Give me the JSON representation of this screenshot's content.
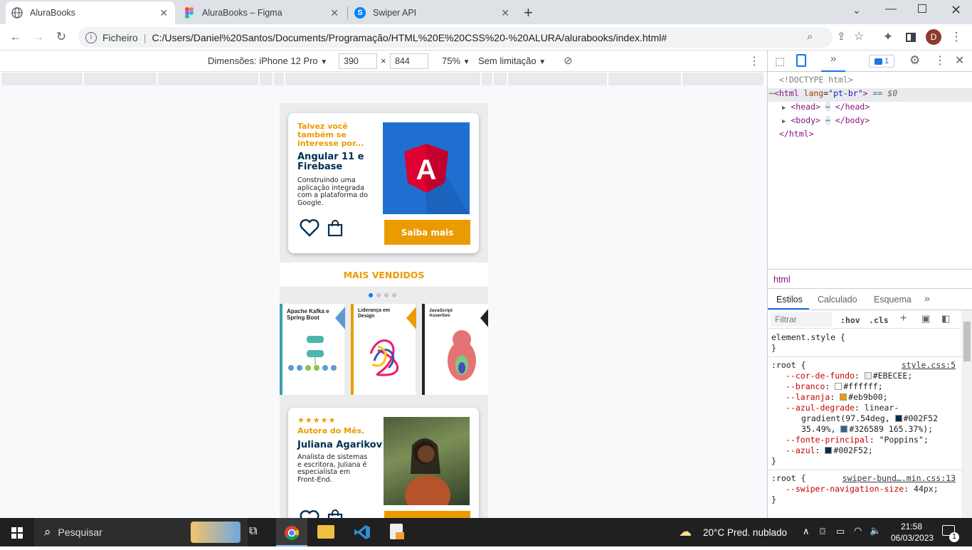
{
  "tabs": [
    {
      "title": "AluraBooks",
      "active": true,
      "icon": "globe-icon"
    },
    {
      "title": "AluraBooks – Figma",
      "active": false,
      "icon": "figma-icon"
    },
    {
      "title": "Swiper API",
      "active": false,
      "icon": "swiper-icon"
    }
  ],
  "address": {
    "protocol_label": "Ficheiro",
    "url": "C:/Users/Daniel%20Santos/Documents/Programação/HTML%20E%20CSS%20-%20ALURA/alurabooks/index.html#"
  },
  "profile_initial": "D",
  "device_toolbar": {
    "dimensions_label": "Dimensões: iPhone 12 Pro",
    "width": "390",
    "x": "×",
    "height": "844",
    "zoom": "75%",
    "throttle": "Sem limitação"
  },
  "phone": {
    "recommend": {
      "kicker": "Talvez você também se interesse por...",
      "title": "Angular 11 e Firebase",
      "description": "Construindo uma aplicação integrada com a plataforma do Google.",
      "button": "Saiba mais"
    },
    "bestsellers_title": "MAIS VENDIDOS",
    "books": [
      {
        "title": "Apache Kafka e Spring Boot",
        "accent": "#3aa0b0"
      },
      {
        "title": "Liderança em Design",
        "accent": "#eb9b00"
      },
      {
        "title": "JavaScript Assertivo",
        "accent": "#222222"
      }
    ],
    "author": {
      "stars": "★★★★★",
      "kicker": "Autora do Mês.",
      "name": "Juliana Agarikov",
      "description": "Analista de sistemas e escritora, Juliana é especialista em Front-End."
    }
  },
  "devtools": {
    "issues_count": "1",
    "dom": {
      "doctype": "<!DOCTYPE html>",
      "html_open_tag": "html",
      "lang_attr": "lang",
      "lang_val": "\"pt-br\"",
      "eq": "== $0",
      "head": "head",
      "body": "body",
      "html_close": "</html>"
    },
    "breadcrumb": "html",
    "panel_tabs": [
      "Estilos",
      "Calculado",
      "Esquema"
    ],
    "filter_placeholder": "Filtrar",
    "hov": ":hov",
    "cls": ".cls",
    "element_style": "element.style {",
    "brace_close": "}",
    "root1": {
      "selector": ":root {",
      "source": "style.css:5",
      "vars": [
        {
          "name": "--cor-de-fundo",
          "value": "#EBECEE",
          "swatch": "#EBECEE"
        },
        {
          "name": "--branco",
          "value": "#ffffff",
          "swatch": "#ffffff"
        },
        {
          "name": "--laranja",
          "value": "#eb9b00",
          "swatch": "#eb9b00"
        },
        {
          "name": "--azul-degrade",
          "value_a": "linear-",
          "value_b": "gradient(97.54deg,",
          "value_c": "#002F52",
          "value_d": "35.49%,",
          "value_e": "#326589 165.37%);",
          "swatch1": "#002F52",
          "swatch2": "#326589"
        },
        {
          "name": "--fonte-principal",
          "value": "\"Poppins\";"
        },
        {
          "name": "--azul",
          "value": "#002F52;",
          "swatch": "#002F52"
        }
      ]
    },
    "root2": {
      "selector": ":root {",
      "source": "swiper-bund….min.css:13",
      "var_name": "--swiper-navigation-size",
      "var_value": "44px;"
    }
  },
  "taskbar": {
    "search": "Pesquisar",
    "weather": "20°C  Pred. nublado",
    "time": "21:58",
    "date": "06/03/2023",
    "notif": "1"
  }
}
